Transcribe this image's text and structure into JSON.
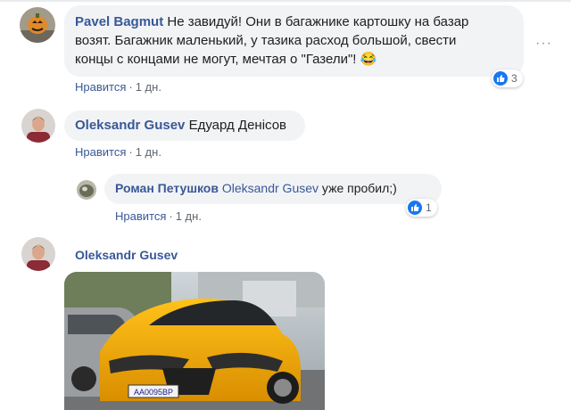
{
  "comments": [
    {
      "author": "Pavel Bagmut",
      "lines": [
        "Не завидуй! Они в багажнике картошку на базар",
        "возят. Багажник маленький, у тазика расход большой, свести",
        "концы с концами не могут, мечтая о \"Газели\"! "
      ],
      "emoji": "😂",
      "like_label": "Нравится",
      "time": "1 дн.",
      "reaction_count": "3"
    },
    {
      "author": "Oleksandr Gusev",
      "text": "Едуард Денісов",
      "like_label": "Нравится",
      "time": "1 дн."
    },
    {
      "author": "Роман Петушков",
      "mention": "Oleksandr Gusev",
      "text": "уже пробил;)",
      "like_label": "Нравится",
      "time": "1 дн.",
      "reaction_count": "1"
    },
    {
      "author": "Oleksandr Gusev",
      "plate": "AA0095BP"
    }
  ],
  "separator": "·",
  "colors": {
    "link": "#385898",
    "bubble": "#f2f3f5",
    "meta": "#606770",
    "like_badge": "#1877f2",
    "car": "#f2a900"
  },
  "icons": {
    "more": "more-options-icon",
    "like": "thumbs-up-icon"
  }
}
